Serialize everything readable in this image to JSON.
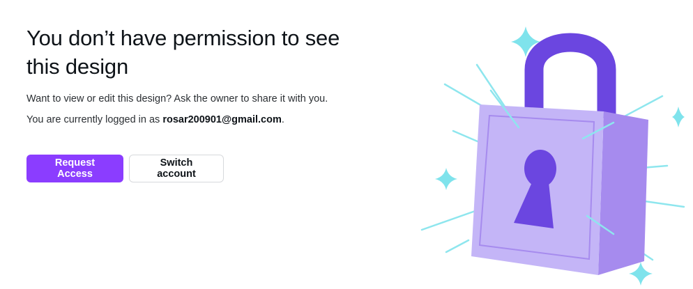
{
  "heading": "You don’t have permission to see this design",
  "description": "Want to view or edit this design? Ask the owner to share it with you.",
  "login": {
    "prefix": "You are currently logged in as ",
    "email": "rosar200901@gmail.com",
    "suffix": "."
  },
  "buttons": {
    "request_access": "Request Access",
    "switch_account": "Switch account"
  },
  "illustration": {
    "icon": "padlock-icon",
    "colors": {
      "shackle": "#6b46e0",
      "body_front": "#c4b5f7",
      "body_side": "#a68bee",
      "keyhole": "#6b46e0",
      "sparkle": "#7fe3ec"
    }
  },
  "colors": {
    "primary_button": "#8b3dff",
    "text": "#0e1318"
  }
}
